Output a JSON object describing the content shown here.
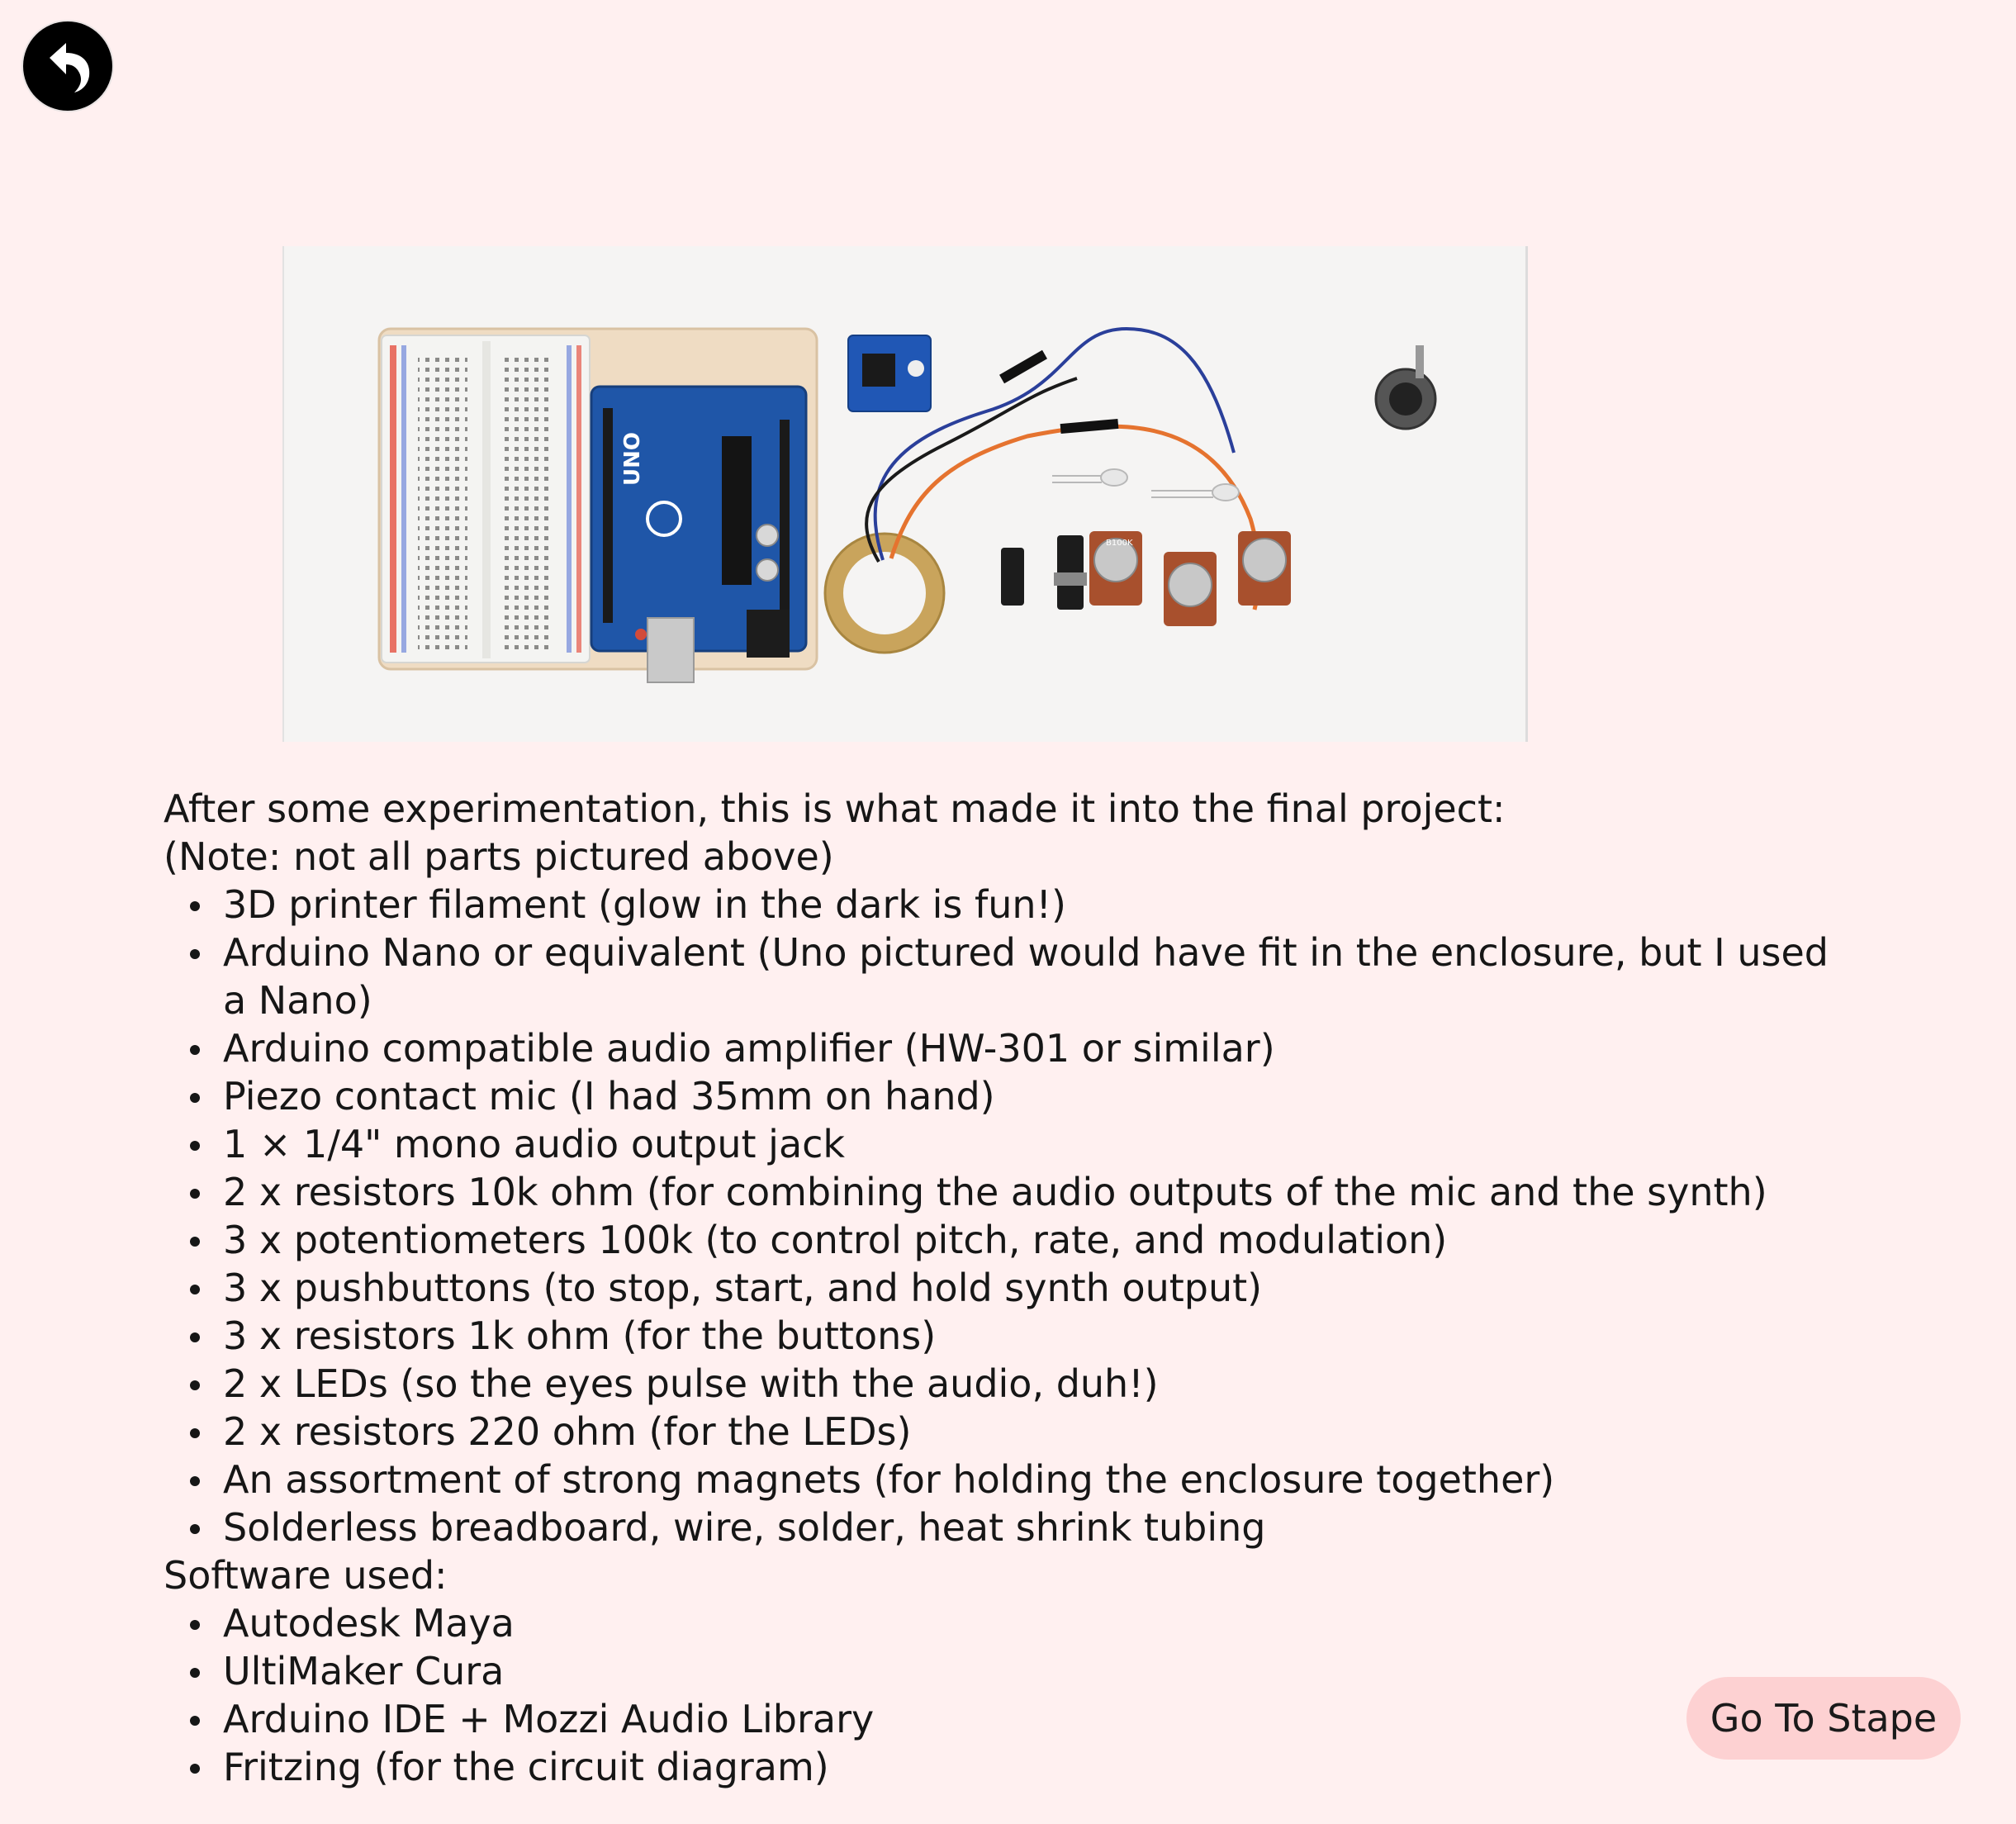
{
  "back_button": {
    "icon": "undo-arrow-icon"
  },
  "photo": {
    "alt": "parts-layout-photo"
  },
  "intro": {
    "line1": "After some experimentation, this is what made it into the final project:",
    "line2": "(Note: not all parts pictured above)"
  },
  "parts": [
    "3D printer filament (glow in the dark is fun!)",
    "Arduino Nano or equivalent (Uno pictured would have fit in the enclosure, but I used a Nano)",
    "Arduino compatible audio amplifier (HW-301 or similar)",
    "Piezo contact mic (I had 35mm on hand)",
    "1 × 1/4\" mono audio output jack",
    "2 x resistors 10k ohm (for combining the audio outputs of the mic and the synth)",
    "3 x potentiometers 100k (to control pitch, rate, and modulation)",
    "3 x pushbuttons (to stop, start, and hold synth output)",
    "3 x resistors 1k ohm (for the buttons)",
    "2 x LEDs (so the eyes pulse with the audio, duh!)",
    "2 x resistors 220 ohm (for the LEDs)",
    "An assortment of strong magnets (for holding the enclosure together)",
    "Solderless breadboard, wire, solder, heat shrink tubing"
  ],
  "software_heading": "Software used:",
  "software": [
    "Autodesk Maya",
    "UltiMaker Cura",
    "Arduino IDE + Mozzi Audio Library",
    "Fritzing (for the circuit diagram)"
  ],
  "stape_button": {
    "label": "Go To Stape"
  },
  "photo_labels": {
    "board_brand": "UNO",
    "pot_label": "B100K"
  },
  "colors": {
    "background": "#fff0f0",
    "button_bg": "#fdd1d2",
    "board_blue": "#1f56a8",
    "wire_blue": "#2a3f9a",
    "wire_orange": "#e5732f"
  }
}
